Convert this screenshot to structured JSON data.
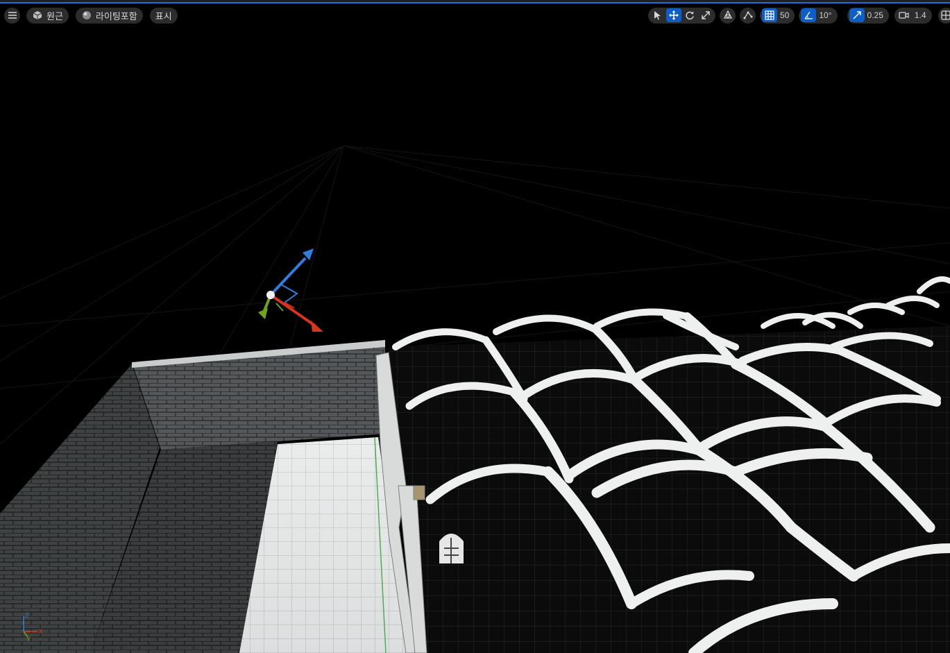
{
  "toolbar_left": {
    "menu_icon": "hamburger-menu-icon",
    "perspective_label": "원근",
    "lighting_label": "라이팅포함",
    "show_label": "표시"
  },
  "toolbar_right": {
    "grid_snap_value": "50",
    "rotation_snap_value": "10°",
    "scale_snap_value": "0.25",
    "camera_speed_value": "1.4"
  },
  "colors": {
    "accent": "#1f6fd6",
    "toolbar_bg": "#2c2c2c",
    "gizmo_x": "#d8341c",
    "gizmo_y": "#6ea31b",
    "gizmo_z": "#2f7fe0"
  },
  "axis_indicator": {
    "x_label": "X",
    "y_label": "Y",
    "z_label": "Z"
  }
}
